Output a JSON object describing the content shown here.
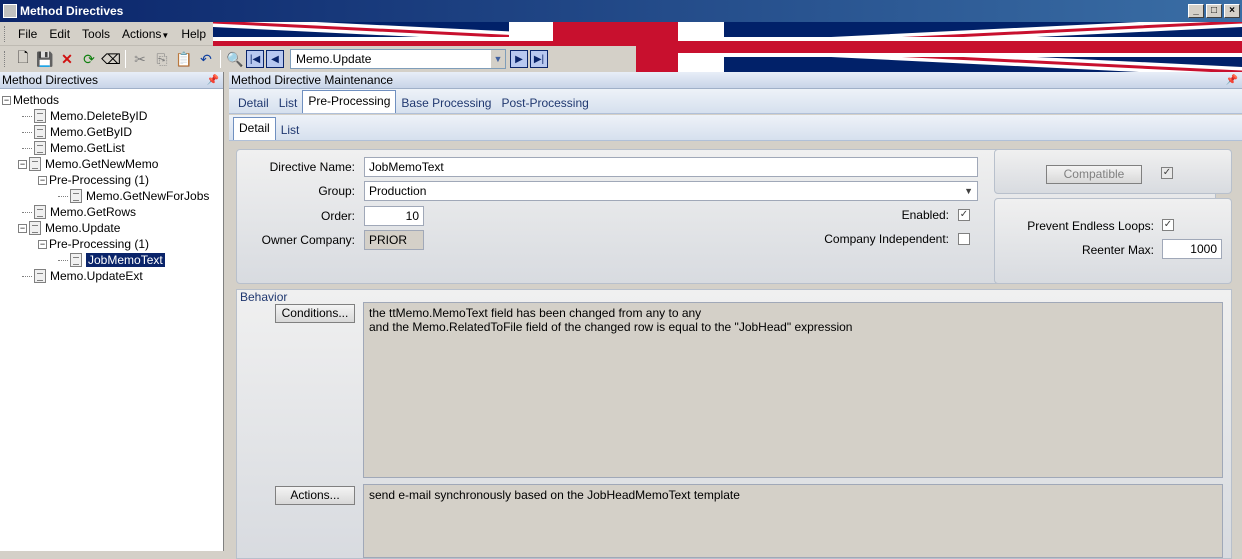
{
  "window": {
    "title": "Method Directives"
  },
  "menu": {
    "items": [
      "File",
      "Edit",
      "Tools",
      "Actions",
      "Help"
    ]
  },
  "toolbar": {
    "method_combo_value": "Memo.Update"
  },
  "left_pane": {
    "title": "Method Directives",
    "tree": [
      {
        "label": "Methods",
        "level": 0
      },
      {
        "label": "Memo.DeleteByID",
        "level": 1
      },
      {
        "label": "Memo.GetByID",
        "level": 1
      },
      {
        "label": "Memo.GetList",
        "level": 1
      },
      {
        "label": "Memo.GetNewMemo",
        "level": 1
      },
      {
        "label": "Pre-Processing (1)",
        "level": 2
      },
      {
        "label": "Memo.GetNewForJobs",
        "level": 3
      },
      {
        "label": "Memo.GetRows",
        "level": 1
      },
      {
        "label": "Memo.Update",
        "level": 1
      },
      {
        "label": "Pre-Processing (1)",
        "level": 2
      },
      {
        "label": "JobMemoText",
        "level": 3,
        "selected": true
      },
      {
        "label": "Memo.UpdateExt",
        "level": 1
      }
    ]
  },
  "right_pane": {
    "title": "Method Directive Maintenance",
    "main_tabs": [
      "Detail",
      "List",
      "Pre-Processing",
      "Base Processing",
      "Post-Processing"
    ],
    "sub_tabs": [
      "Detail",
      "List"
    ],
    "form": {
      "directive_name_label": "Directive Name:",
      "directive_name_value": "JobMemoText",
      "group_label": "Group:",
      "group_value": "Production",
      "order_label": "Order:",
      "order_value": "10",
      "owner_company_label": "Owner Company:",
      "owner_company_value": "PRIOR",
      "enabled_label": "Enabled:",
      "company_independent_label": "Company Independent:",
      "compatible_label": "Compatible",
      "prevent_loops_label": "Prevent Endless Loops:",
      "reenter_max_label": "Reenter Max:",
      "reenter_max_value": "1000"
    },
    "behavior": {
      "title": "Behavior",
      "conditions_button": "Conditions...",
      "conditions_line1": "the ttMemo.MemoText field has been changed from any to any",
      "conditions_line2": "and the Memo.RelatedToFile field of the changed row is equal to the \"JobHead\" expression",
      "actions_button": "Actions...",
      "actions_text": "send e-mail synchronously based on the JobHeadMemoText template"
    }
  }
}
